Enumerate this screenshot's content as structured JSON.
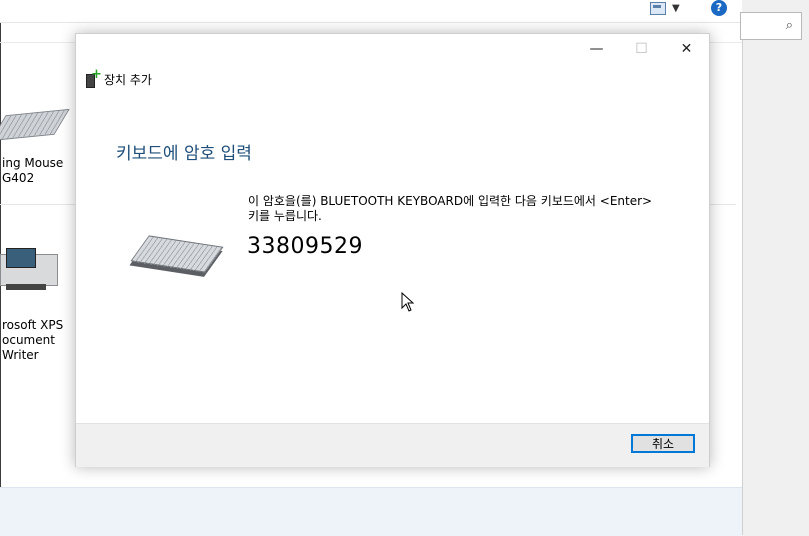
{
  "background": {
    "device1_label_line1": "ing Mouse",
    "device1_label_line2": "G402",
    "device2_label_line1": "rosoft XPS",
    "device2_label_line2": "ocument",
    "device2_label_line3": "Writer",
    "help_glyph": "?",
    "dropdown_glyph": "▼",
    "search_glyph": "⌕"
  },
  "dialog": {
    "minimize": "—",
    "maximize": "☐",
    "close": "✕",
    "title": "장치 추가",
    "heading": "키보드에 암호 입력",
    "instruction": "이 암호을(를) BLUETOOTH KEYBOARD에 입력한 다음 키보드에서 <Enter> 키를 누릅니다.",
    "passcode": "33809529",
    "cancel_label": "취소"
  }
}
